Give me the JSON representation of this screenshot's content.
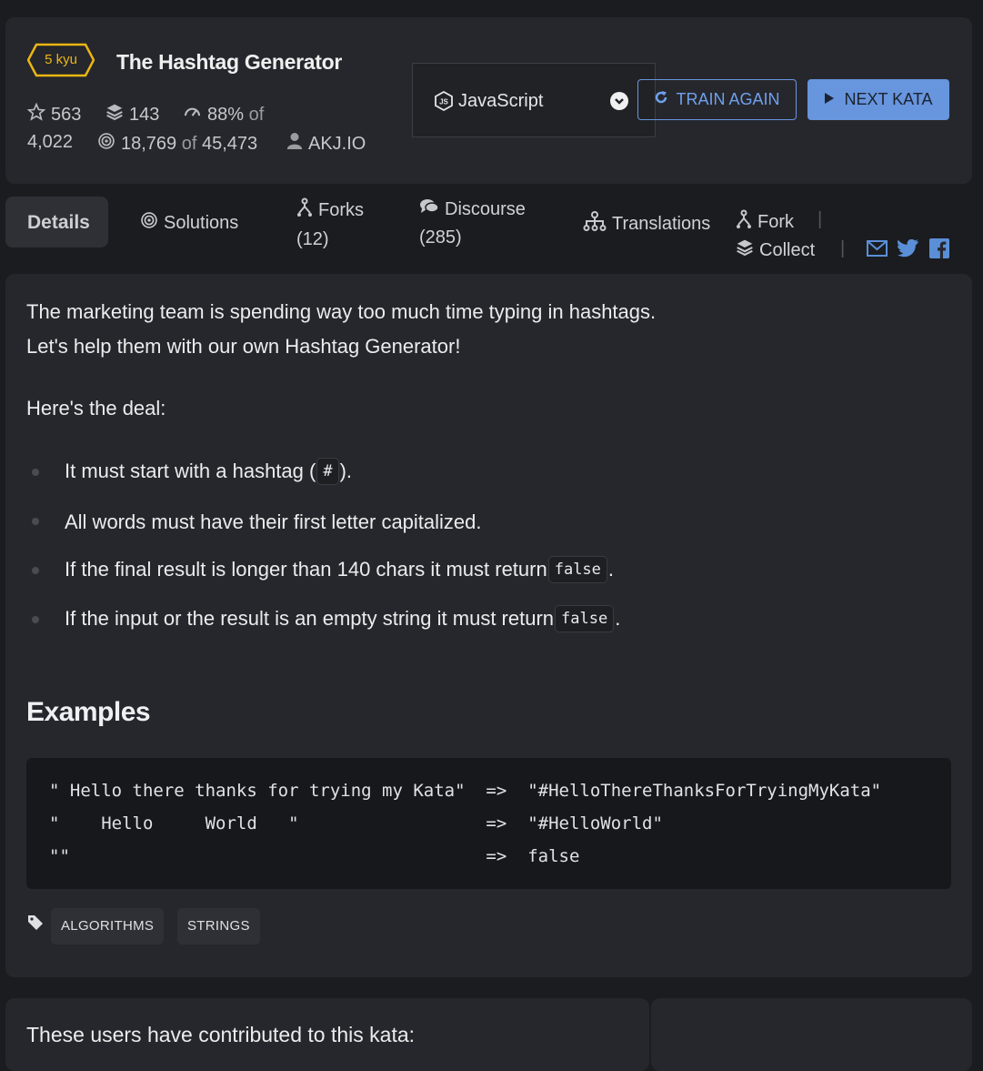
{
  "kata": {
    "rank": "5 kyu",
    "title": "The Hashtag Generator",
    "stars": "563",
    "collections": "143",
    "satisfaction": "88%",
    "of_word": "of",
    "votes": "4,022",
    "completed": "18,769",
    "total_attempts": "45,473",
    "author": "AKJ.IO"
  },
  "language_select": {
    "value": "JavaScript",
    "icon": "nodejs-icon"
  },
  "buttons": {
    "train_again": "TRAIN AGAIN",
    "next_kata": "NEXT KATA"
  },
  "tabs": {
    "details": "Details",
    "solutions": "Solutions",
    "forks": "Forks",
    "forks_count": "(12)",
    "discourse": "Discourse",
    "discourse_count": "(285)",
    "translations": "Translations",
    "fork": "Fork",
    "collect": "Collect",
    "separator": "|"
  },
  "description": {
    "line1": "The marketing team is spending way too much time typing in hashtags.",
    "line2": "Let's help them with our own Hashtag Generator!",
    "line3": "Here's the deal:",
    "rules": [
      {
        "before": "It must start with a hashtag (",
        "code": "#",
        "after": ")."
      },
      {
        "before": "All words must have their first letter capitalized.",
        "code": "",
        "after": ""
      },
      {
        "before": "If the final result is longer than 140 chars it must return ",
        "code": "false",
        "after": "."
      },
      {
        "before": "If the input or the result is an empty string it must return ",
        "code": "false",
        "after": "."
      }
    ]
  },
  "examples": {
    "heading": "Examples",
    "lines": [
      "\" Hello there thanks for trying my Kata\"  =>  \"#HelloThereThanksForTryingMyKata\"",
      "\"    Hello     World   \"                  =>  \"#HelloWorld\"",
      "\"\"                                        =>  false"
    ]
  },
  "tags": [
    "ALGORITHMS",
    "STRINGS"
  ],
  "contributors": {
    "title": "These users have contributed to this kata:"
  },
  "colors": {
    "accent": "#6795de",
    "rank": "#ecb613",
    "panel": "#26272c",
    "background": "#1b1c20"
  }
}
